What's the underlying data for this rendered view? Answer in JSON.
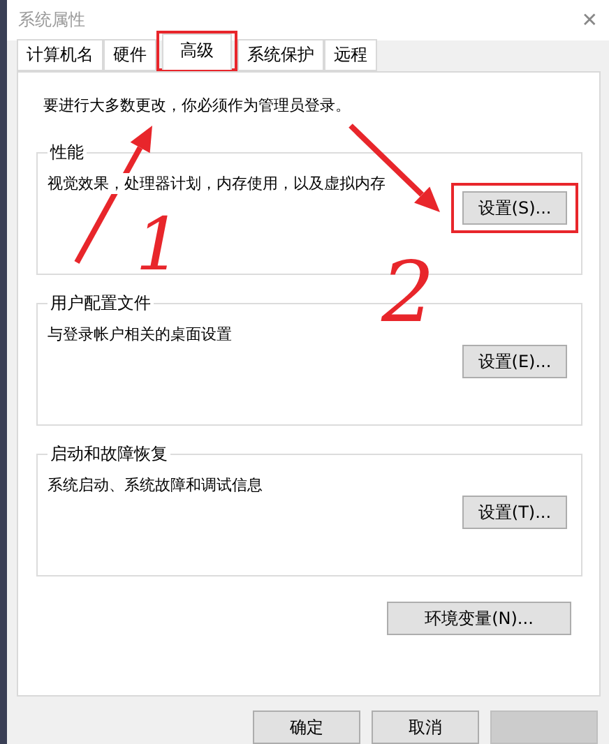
{
  "window": {
    "title": "系统属性",
    "close": "✕"
  },
  "tabs": [
    {
      "label": "计算机名",
      "selected": false,
      "highlighted": false
    },
    {
      "label": "硬件",
      "selected": false,
      "highlighted": false
    },
    {
      "label": "高级",
      "selected": true,
      "highlighted": true
    },
    {
      "label": "系统保护",
      "selected": false,
      "highlighted": false
    },
    {
      "label": "远程",
      "selected": false,
      "highlighted": false
    }
  ],
  "notice": "要进行大多数更改，你必须作为管理员登录。",
  "groups": [
    {
      "title": "性能",
      "description": "视觉效果，处理器计划，内存使用，以及虚拟内存",
      "button": "设置(S)...",
      "highlighted": true
    },
    {
      "title": "用户配置文件",
      "description": "与登录帐户相关的桌面设置",
      "button": "设置(E)...",
      "highlighted": false
    },
    {
      "title": "启动和故障恢复",
      "description": "系统启动、系统故障和调试信息",
      "button": "设置(T)...",
      "highlighted": false
    }
  ],
  "env_button": "环境变量(N)...",
  "footer_buttons": [
    {
      "label": "确定",
      "disabled": false
    },
    {
      "label": "取消",
      "disabled": false
    },
    {
      "disabled": true
    }
  ],
  "annotations": {
    "labels": [
      "1",
      "2"
    ]
  }
}
